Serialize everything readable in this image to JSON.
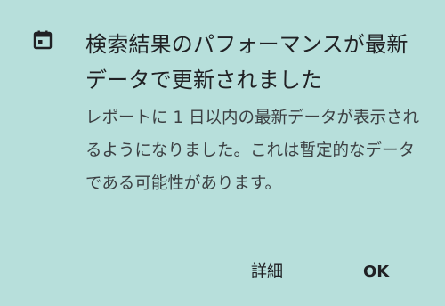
{
  "dialog": {
    "icon": "calendar-icon",
    "title": "検索結果のパフォーマンスが最新データで更新されました",
    "body": "レポートに 1 日以内の最新データが表示されるようになりました。これは暫定的なデータである可能性があります。",
    "actions": {
      "details_label": "詳細",
      "ok_label": "OK"
    }
  },
  "colors": {
    "background": "#b7dfdb",
    "text": "#202124"
  }
}
